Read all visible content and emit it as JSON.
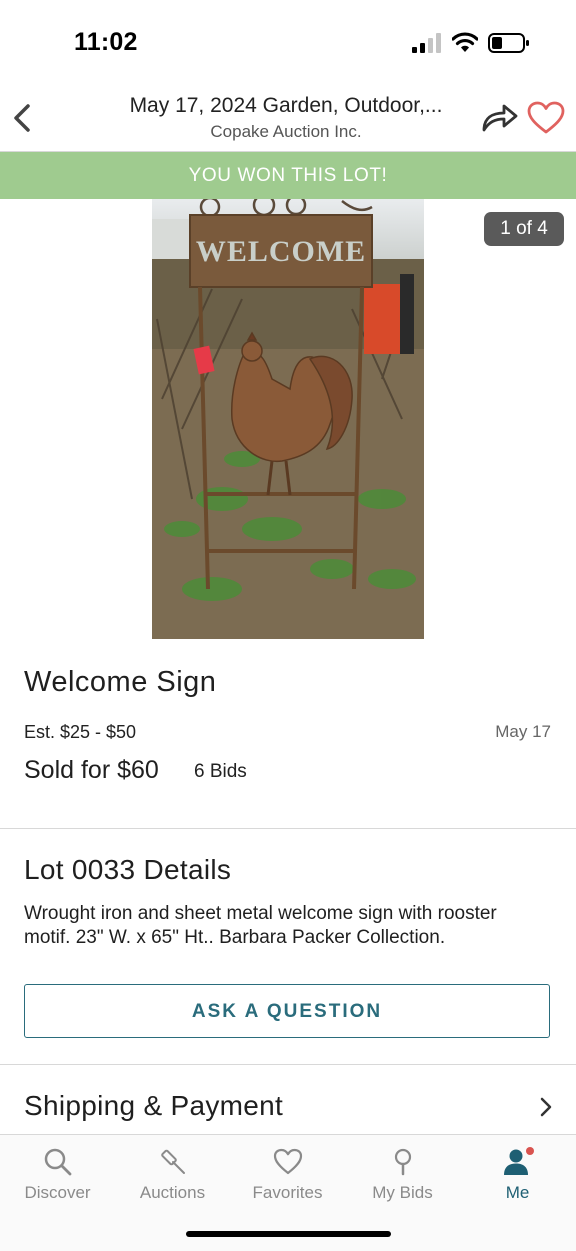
{
  "status_bar": {
    "time": "11:02"
  },
  "header": {
    "title": "May 17, 2024 Garden, Outdoor,...",
    "subtitle": "Copake Auction Inc."
  },
  "banner": {
    "text": "YOU WON THIS LOT!",
    "color": "#9fcb8f"
  },
  "image": {
    "counter": "1 of 4",
    "sign_text": "WELCOME"
  },
  "item": {
    "title": "Welcome Sign",
    "estimate": "Est. $25 - $50",
    "date": "May 17",
    "sold": "Sold for $60",
    "bids": "6 Bids"
  },
  "details": {
    "title": "Lot 0033 Details",
    "description": "Wrought iron and sheet metal welcome sign with rooster motif. 23\" W. x 65\" Ht.. Barbara Packer Collection.",
    "ask_button": "ASK A QUESTION"
  },
  "shipping": {
    "label": "Shipping & Payment"
  },
  "tabs": [
    {
      "label": "Discover",
      "icon": "search-icon"
    },
    {
      "label": "Auctions",
      "icon": "gavel-icon"
    },
    {
      "label": "Favorites",
      "icon": "heart-icon"
    },
    {
      "label": "My Bids",
      "icon": "paddle-icon"
    },
    {
      "label": "Me",
      "icon": "person-icon",
      "active": true
    }
  ],
  "colors": {
    "accent": "#1e5f73",
    "favorite": "#e0625f",
    "notification_dot": "#d9534f"
  }
}
